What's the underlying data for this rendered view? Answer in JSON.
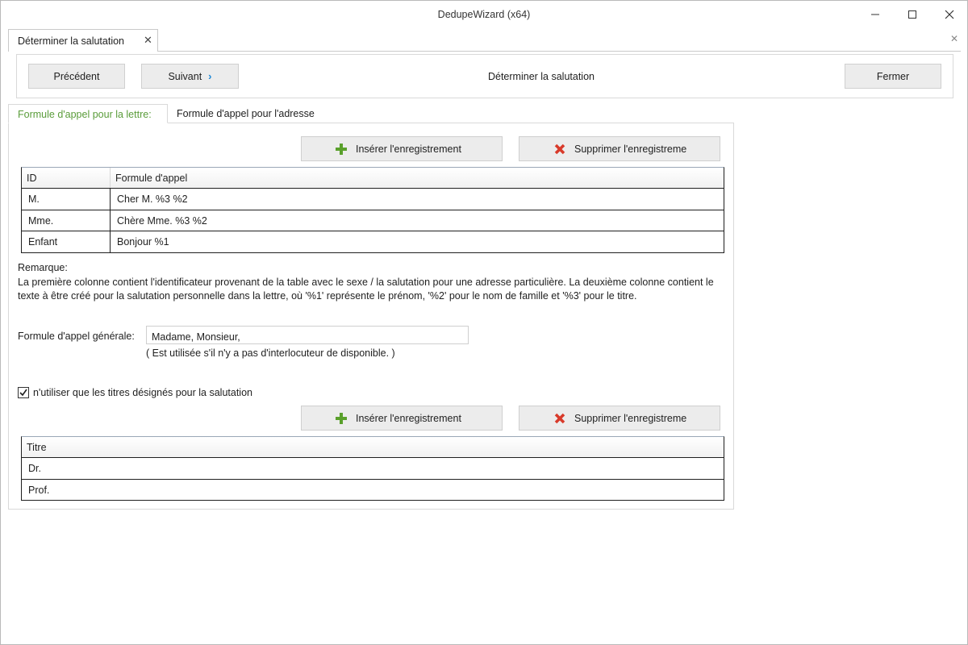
{
  "window": {
    "title": "DedupeWizard  (x64)"
  },
  "doc_tab": {
    "label": "Déterminer la salutation"
  },
  "toolbar": {
    "prev_label": "Précédent",
    "next_label": "Suivant",
    "title": "Déterminer la salutation",
    "close_label": "Fermer"
  },
  "tabs": [
    {
      "label": "Formule d'appel pour la lettre:",
      "active": true
    },
    {
      "label": "Formule d'appel pour l'adresse",
      "active": false
    }
  ],
  "insert_label": "Insérer l'enregistrement",
  "delete_label": "Supprimer l'enregistreme",
  "salutation_grid": {
    "columns": [
      "ID",
      "Formule d'appel"
    ],
    "rows": [
      [
        "M.",
        "Cher M. %3 %2"
      ],
      [
        "Mme.",
        "Chère Mme. %3 %2"
      ],
      [
        "Enfant",
        "Bonjour %1"
      ]
    ]
  },
  "remark": {
    "heading": "Remarque:",
    "text": "La première colonne contient l'identificateur provenant de la table avec le sexe / la salutation pour une adresse particulière. La deuxième colonne contient le texte à être créé pour la salutation personnelle dans la lettre, où '%1' représente le prénom, '%2' pour le nom de famille et '%3' pour le titre."
  },
  "general": {
    "label": "Formule d'appel générale:",
    "value": "Madame, Monsieur,",
    "hint": "( Est utilisée s'il n'y a pas d'interlocuteur de disponible. )"
  },
  "checkbox": {
    "label": "n'utiliser que les titres désignés pour la salutation",
    "checked": true
  },
  "titles_grid": {
    "column": "Titre",
    "rows": [
      "Dr.",
      "Prof."
    ]
  },
  "colors": {
    "active_tab": "#5a9c3a",
    "chevron": "#1e88d6",
    "insert_icon": "#5aa02c",
    "delete_icon": "#d83a2a"
  }
}
